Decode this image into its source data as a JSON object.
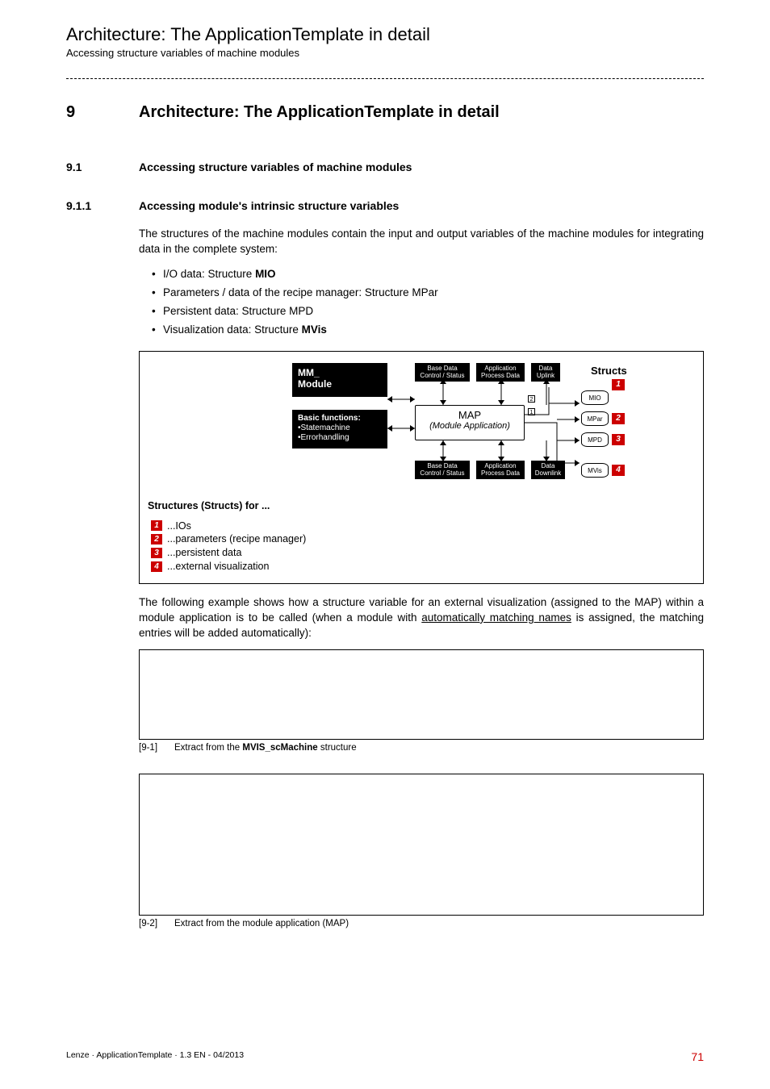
{
  "header": {
    "title": "Architecture: The ApplicationTemplate in detail",
    "subtitle": "Accessing structure variables of machine modules"
  },
  "section": {
    "num": "9",
    "title": "Architecture: The ApplicationTemplate in detail"
  },
  "sub1": {
    "num": "9.1",
    "title": "Accessing structure variables of machine modules"
  },
  "sub2": {
    "num": "9.1.1",
    "title": "Accessing module's intrinsic structure variables"
  },
  "para1": "The structures of the machine modules contain the input and output variables of the machine modules for integrating data in the complete system:",
  "bullets": {
    "b1_pre": "I/O data: Structure ",
    "b1_bold": "MIO",
    "b2": "Parameters / data of the recipe manager: Structure MPar",
    "b3": "Persistent data: Structure MPD",
    "b4_pre": "Visualization data: Structure ",
    "b4_bold": "MVis"
  },
  "diagram": {
    "mm_line1": "MM_",
    "mm_line2": "Module",
    "bf_title": "Basic functions:",
    "bf_line1": "•Statemachine",
    "bf_line2": "•Errorhandling",
    "top1_line1": "Base Data",
    "top1_line2": "Control / Status",
    "top2_line1": "Application",
    "top2_line2": "Process Data",
    "top3_line1": "Data",
    "top3_line2": "Uplink",
    "bot3_line1": "Data",
    "bot3_line2": "Downlink",
    "map_title": "MAP",
    "map_sub": "(Module Application)",
    "structs_label": "Structs",
    "cyl1": "MIO",
    "cyl2": "MPar",
    "cyl3": "MPD",
    "cyl4": "MVis",
    "n1": "1",
    "n2": "2",
    "n3": "3",
    "n4": "4",
    "cnum1": "1",
    "cnum2": "2"
  },
  "diag_legend": {
    "title": "Structures (Structs) for ...",
    "l1": "...IOs",
    "l2": "...parameters (recipe manager)",
    "l3": "...persistent data",
    "l4": "...external visualization",
    "n1": "1",
    "n2": "2",
    "n3": "3",
    "n4": "4"
  },
  "para2_a": "The following example shows how a structure variable for an external visualization (assigned to the MAP) within a module application is to be called (when a module with ",
  "para2_u": "automatically matching names",
  "para2_b": " is assigned, the matching entries will be added automatically):",
  "cap1": {
    "tag": "[9-1]",
    "text_a": "Extract from the ",
    "text_b": "MVIS_scMachine",
    "text_c": " structure"
  },
  "cap2": {
    "tag": "[9-2]",
    "text": "Extract from the module application (MAP)"
  },
  "footer": {
    "left": "Lenze · ApplicationTemplate · 1.3 EN - 04/2013",
    "page": "71"
  }
}
